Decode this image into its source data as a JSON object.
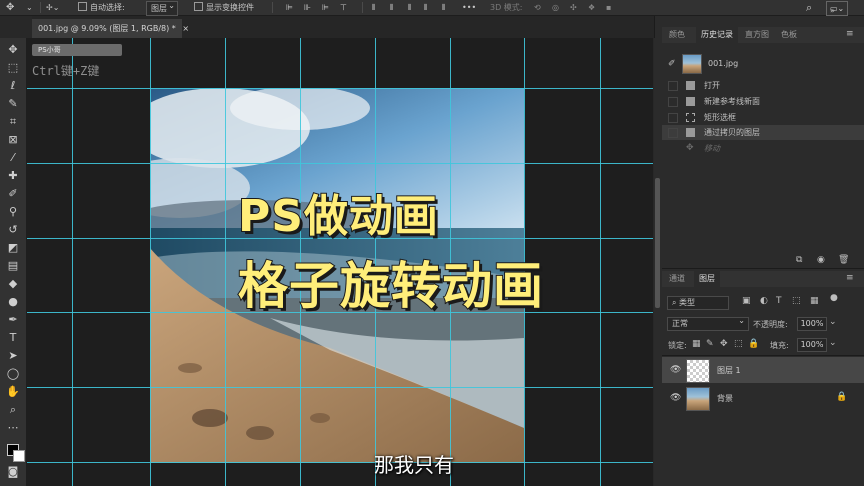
{
  "options_bar": {
    "auto_select_label": "自动选择:",
    "auto_select_value": "图层",
    "show_transform_label": "显示变换控件",
    "mode_3d_label": "3D 模式:",
    "more_label": "•••"
  },
  "document_tab": {
    "title": "001.jpg @ 9.09% (图层 1, RGB/8) *",
    "close": "×"
  },
  "canvas": {
    "overlay_tag": "PS小哥",
    "shortcut_hint": "Ctrl键+Z键",
    "headline_line1": "PS做动画",
    "headline_line2": "格子旋转动画",
    "subtitle": "那我只有"
  },
  "panels_top": {
    "tabs": [
      "颜色",
      "历史记录",
      "直方图",
      "色板"
    ],
    "active_tab": "历史记录",
    "snapshot_name": "001.jpg",
    "history": [
      "打开",
      "新建参考线新面",
      "矩形选框",
      "通过拷贝的图层",
      "移动"
    ]
  },
  "panels_layers": {
    "tabs": [
      "通道",
      "图层"
    ],
    "active_tab": "图层",
    "filter_kind": "类型",
    "blend_mode": "正常",
    "opacity_label": "不透明度:",
    "opacity_value": "100%",
    "lock_label": "锁定:",
    "fill_label": "填充:",
    "fill_value": "100%",
    "layers": [
      {
        "name": "图层 1",
        "selected": true
      },
      {
        "name": "背景",
        "selected": false
      }
    ]
  },
  "colors": {
    "guide": "#3fc7dc",
    "headline": "#ffee7a",
    "panel_bg": "#2b2b2b",
    "canvas_bg": "#1e1e1e"
  }
}
